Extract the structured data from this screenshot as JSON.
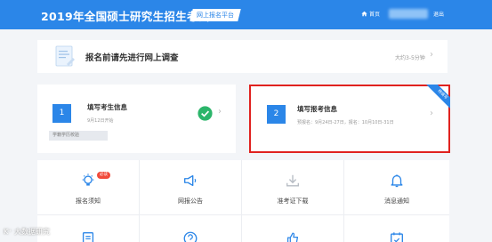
{
  "header": {
    "title": "2019年全国硕士研究生招生考试",
    "tag": "网上报名平台",
    "home": "首页",
    "logout": "退出"
  },
  "survey": {
    "text": "报名前请先进行网上调查",
    "time": "大约3-5分钟"
  },
  "steps": [
    {
      "num": "1",
      "title": "填写考生信息",
      "sub": "9月12日开始",
      "verify": "学籍学历校验"
    },
    {
      "num": "2",
      "title": "填写报考信息",
      "sub": "预报名：9月24日-27日，报名：10月10日-31日",
      "ribbon": "待填写"
    }
  ],
  "grid": {
    "items": [
      {
        "label": "报名须知",
        "icon": "bulb-icon",
        "badge": "必读"
      },
      {
        "label": "网报公告",
        "icon": "megaphone-icon"
      },
      {
        "label": "准考证下载",
        "icon": "download-icon"
      },
      {
        "label": "消息通知",
        "icon": "bell-icon"
      }
    ],
    "row2_icons": [
      "document-icon",
      "help-icon",
      "thumbs-up-icon",
      "calendar-check-icon"
    ]
  },
  "watermark": "K⁺ 大数据研究",
  "colors": {
    "primary": "#2b86e8",
    "highlight": "#e0221f",
    "success": "#2bb56a",
    "badge": "#f14a3a"
  }
}
